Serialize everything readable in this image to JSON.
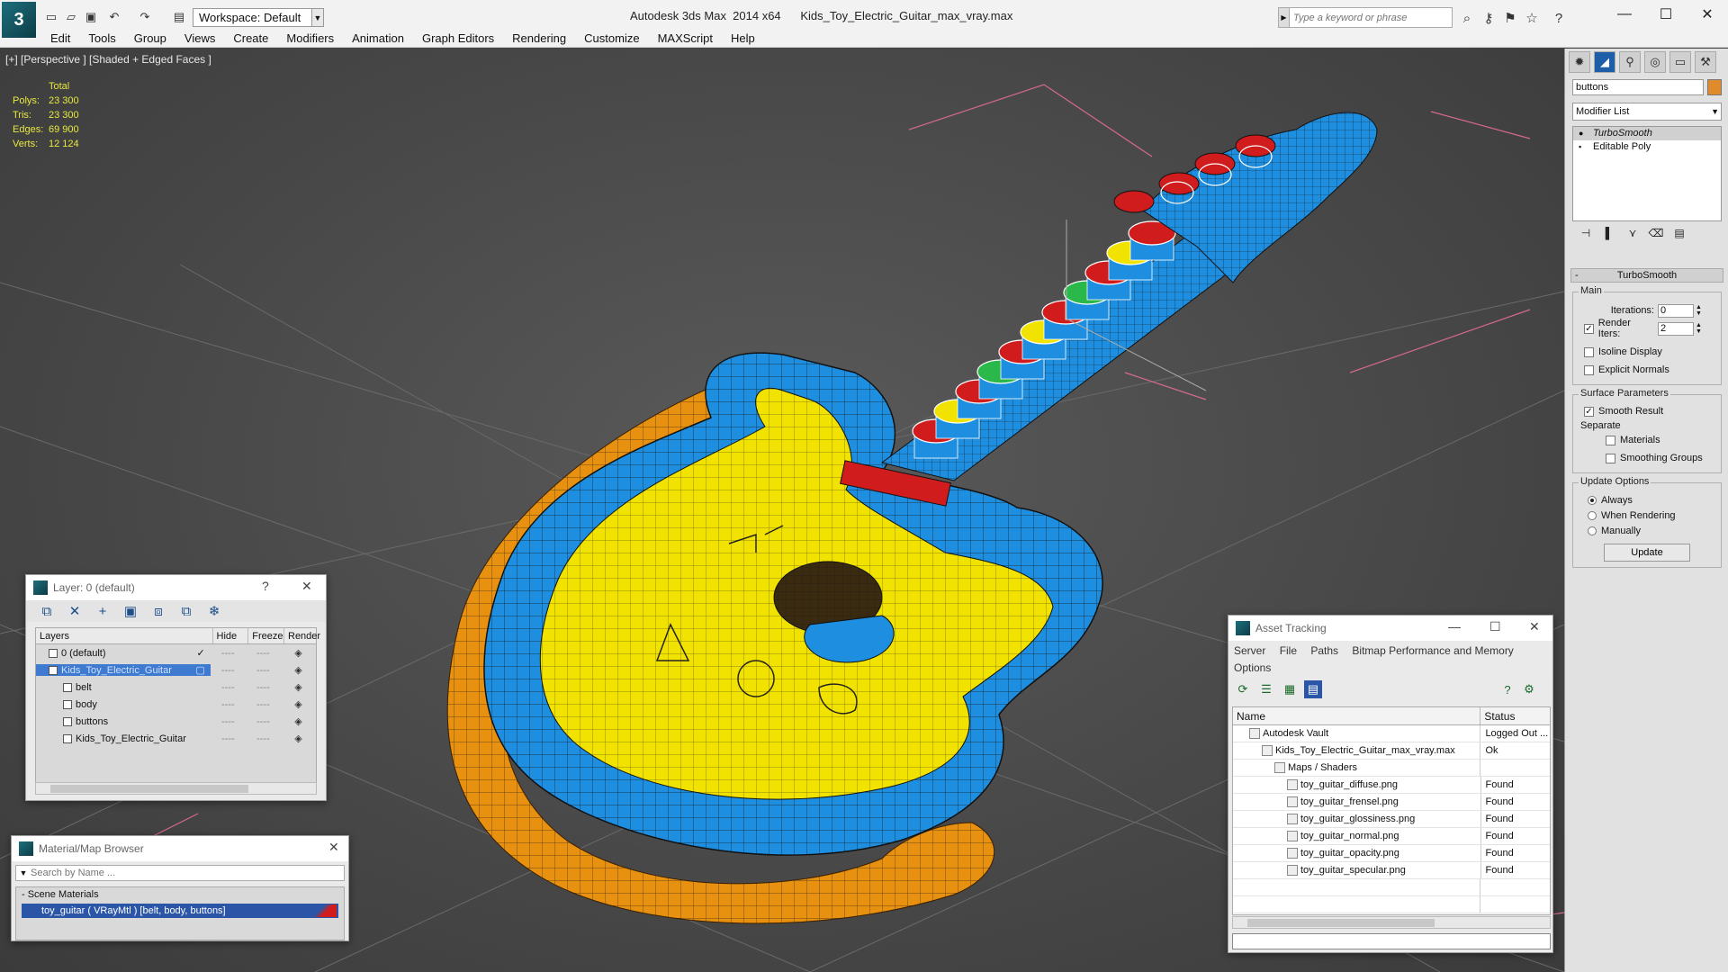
{
  "window": {
    "title": "Autodesk 3ds Max  2014 x64      Kids_Toy_Electric_Guitar_max_vray.max",
    "workspace": "Workspace: Default",
    "search_placeholder": "Type a keyword or phrase"
  },
  "menu": [
    "Edit",
    "Tools",
    "Group",
    "Views",
    "Create",
    "Modifiers",
    "Animation",
    "Graph Editors",
    "Rendering",
    "Customize",
    "MAXScript",
    "Help"
  ],
  "viewport": {
    "label": "[+] [Perspective ] [Shaded + Edged Faces ]",
    "stats_header": "Total",
    "stats": [
      {
        "k": "Polys:",
        "v": "23 300"
      },
      {
        "k": "Tris:",
        "v": "23 300"
      },
      {
        "k": "Edges:",
        "v": "69 900"
      },
      {
        "k": "Verts:",
        "v": "12 124"
      }
    ],
    "colors": {
      "body_blue": "#1e8fe0",
      "pickguard_yellow": "#f2e200",
      "strap_orange": "#e8900f",
      "wire": "#1a1a1a"
    }
  },
  "layer_window": {
    "title": "Layer: 0 (default)",
    "help": "?",
    "columns": [
      "Layers",
      "Hide",
      "Freeze",
      "Render"
    ],
    "rows": [
      {
        "name": "0 (default)",
        "indent": 0,
        "mark": "✓",
        "selected": false
      },
      {
        "name": "Kids_Toy_Electric_Guitar",
        "indent": 0,
        "mark": "▢",
        "selected": true
      },
      {
        "name": "belt",
        "indent": 1,
        "mark": "",
        "selected": false
      },
      {
        "name": "body",
        "indent": 1,
        "mark": "",
        "selected": false
      },
      {
        "name": "buttons",
        "indent": 1,
        "mark": "",
        "selected": false
      },
      {
        "name": "Kids_Toy_Electric_Guitar",
        "indent": 1,
        "mark": "",
        "selected": false
      }
    ],
    "cell_dash": "----"
  },
  "material_browser": {
    "title": "Material/Map Browser",
    "search": "Search by Name ...",
    "group": "- Scene Materials",
    "item": "toy_guitar  ( VRayMtl )  [belt, body, buttons]"
  },
  "asset_tracking": {
    "title": "Asset Tracking",
    "menu": [
      "Server",
      "File",
      "Paths",
      "Bitmap Performance and Memory",
      "Options"
    ],
    "columns": [
      "Name",
      "Status"
    ],
    "rows": [
      {
        "name": "Autodesk Vault",
        "indent": 1,
        "status": "Logged Out ..."
      },
      {
        "name": "Kids_Toy_Electric_Guitar_max_vray.max",
        "indent": 2,
        "status": "Ok"
      },
      {
        "name": "Maps / Shaders",
        "indent": 3,
        "status": ""
      },
      {
        "name": "toy_guitar_diffuse.png",
        "indent": 4,
        "status": "Found"
      },
      {
        "name": "toy_guitar_frensel.png",
        "indent": 4,
        "status": "Found"
      },
      {
        "name": "toy_guitar_glossiness.png",
        "indent": 4,
        "status": "Found"
      },
      {
        "name": "toy_guitar_normal.png",
        "indent": 4,
        "status": "Found"
      },
      {
        "name": "toy_guitar_opacity.png",
        "indent": 4,
        "status": "Found"
      },
      {
        "name": "toy_guitar_specular.png",
        "indent": 4,
        "status": "Found"
      }
    ]
  },
  "command_panel": {
    "object_name": "buttons",
    "modifier_list": "Modifier List",
    "stack": [
      "TurboSmooth",
      "Editable Poly"
    ],
    "rollout_title": "TurboSmooth",
    "main_label": "Main",
    "iterations_label": "Iterations:",
    "iterations_value": "0",
    "render_iters_label": "Render Iters:",
    "render_iters_value": "2",
    "isoline": "Isoline Display",
    "explicit_normals": "Explicit Normals",
    "surface_params": "Surface Parameters",
    "smooth_result": "Smooth Result",
    "separate": "Separate",
    "materials": "Materials",
    "smoothing_groups": "Smoothing Groups",
    "update_options": "Update Options",
    "always": "Always",
    "when_rendering": "When Rendering",
    "manually": "Manually",
    "update_button": "Update"
  }
}
